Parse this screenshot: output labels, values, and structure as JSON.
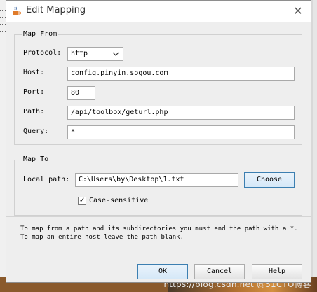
{
  "window": {
    "title": "Edit Mapping",
    "close_glyph": "✕"
  },
  "map_from": {
    "title": "Map From",
    "protocol_label": "Protocol:",
    "protocol_value": "http",
    "host_label": "Host:",
    "host_value": "config.pinyin.sogou.com",
    "port_label": "Port:",
    "port_value": "80",
    "path_label": "Path:",
    "path_value": "/api/toolbox/geturl.php",
    "query_label": "Query:",
    "query_value": "*"
  },
  "map_to": {
    "title": "Map To",
    "local_path_label": "Local path:",
    "local_path_value": "C:\\Users\\by\\Desktop\\1.txt",
    "choose_label": "Choose",
    "case_sensitive_label": "Case-sensitive",
    "case_sensitive_checked": true
  },
  "hint_text": "To map from a path and its subdirectories you must end the path with a *. To map an entire host leave the path blank.",
  "buttons": {
    "ok": "OK",
    "cancel": "Cancel",
    "help": "Help"
  },
  "background": {
    "watermark": "https://blog.csdn.net @51CTO博客"
  },
  "colors": {
    "focus_border": "#3c7fb1",
    "window_bg": "#eeeeee"
  },
  "icons": {
    "app": "java-cup-icon",
    "close": "close-icon",
    "dropdown": "chevron-down-icon",
    "check": "checkmark-icon"
  }
}
